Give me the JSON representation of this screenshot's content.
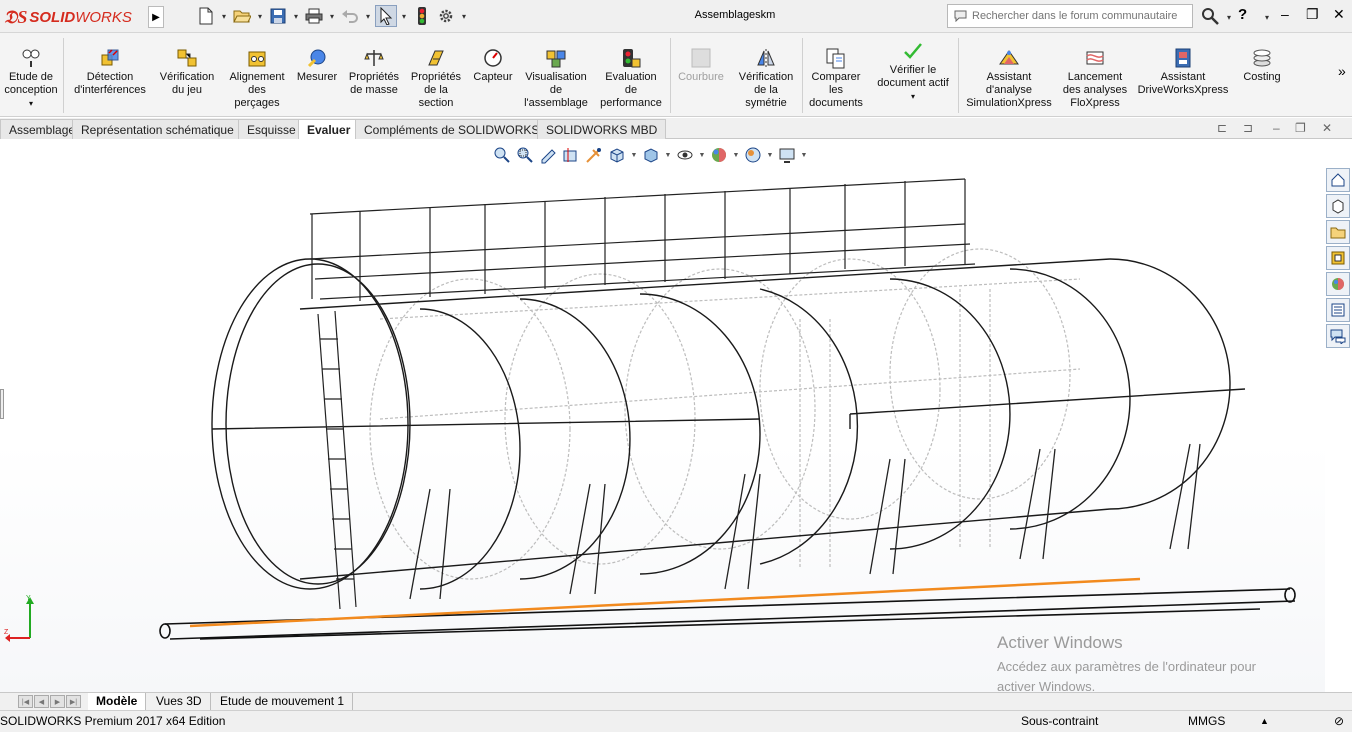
{
  "app": {
    "name_prefix": "SOLID",
    "name_suffix": "WORKS",
    "document_title": "Assemblageskm"
  },
  "search": {
    "placeholder": "Rechercher dans le forum communautaire"
  },
  "toolbar_icons": [
    "new-doc-icon",
    "open-icon",
    "save-icon",
    "print-icon",
    "undo-icon",
    "select-icon",
    "traffic-light-icon",
    "options-gear-icon"
  ],
  "commands": [
    {
      "label": "Etude de\nconception",
      "icon": "design-study-icon"
    },
    {
      "label": "Détection\nd'interférences",
      "icon": "interference-icon"
    },
    {
      "label": "Vérification\ndu jeu",
      "icon": "clearance-icon"
    },
    {
      "label": "Alignement\ndes\nperçages",
      "icon": "hole-alignment-icon"
    },
    {
      "label": "Mesurer",
      "icon": "measure-icon"
    },
    {
      "label": "Propriétés\nde masse",
      "icon": "mass-properties-icon"
    },
    {
      "label": "Propriétés\nde la\nsection",
      "icon": "section-properties-icon"
    },
    {
      "label": "Capteur",
      "icon": "sensor-icon"
    },
    {
      "label": "Visualisation\nde\nl'assemblage",
      "icon": "assembly-visualization-icon"
    },
    {
      "label": "Evaluation\nde\nperformance",
      "icon": "performance-icon"
    },
    {
      "label": "Courbure",
      "icon": "curvature-icon",
      "disabled": true
    },
    {
      "label": "Vérification\nde la\nsymétrie",
      "icon": "symmetry-icon"
    },
    {
      "label": "Comparer\nles\ndocuments",
      "icon": "compare-icon"
    },
    {
      "label": "Vérifier le\ndocument actif",
      "icon": "check-doc-icon"
    },
    {
      "label": "Assistant\nd'analyse\nSimulationXpress",
      "icon": "simulationxpress-icon"
    },
    {
      "label": "Lancement\ndes analyses\nFloXpress",
      "icon": "floxpress-icon"
    },
    {
      "label": "Assistant\nDriveWorksXpress",
      "icon": "driveworks-icon"
    },
    {
      "label": "Costing",
      "icon": "costing-icon"
    }
  ],
  "tabs": [
    {
      "label": "Assemblage"
    },
    {
      "label": "Représentation schématique"
    },
    {
      "label": "Esquisse"
    },
    {
      "label": "Evaluer",
      "active": true
    },
    {
      "label": "Compléments de SOLIDWORKS"
    },
    {
      "label": "SOLIDWORKS MBD"
    }
  ],
  "bottom_tabs": [
    {
      "label": "Modèle",
      "active": true
    },
    {
      "label": "Vues 3D"
    },
    {
      "label": "Etude de mouvement 1"
    }
  ],
  "status": {
    "edition": "SOLIDWORKS Premium 2017 x64 Edition",
    "constraint": "Sous-contraint",
    "units": "MMGS"
  },
  "activate_windows": {
    "title": "Activer Windows",
    "line1": "Accédez aux paramètres de l'ordinateur pour",
    "line2": "activer Windows."
  },
  "colors": {
    "brand_red": "#d52b1e",
    "highlight_orange": "#f28a1e"
  }
}
